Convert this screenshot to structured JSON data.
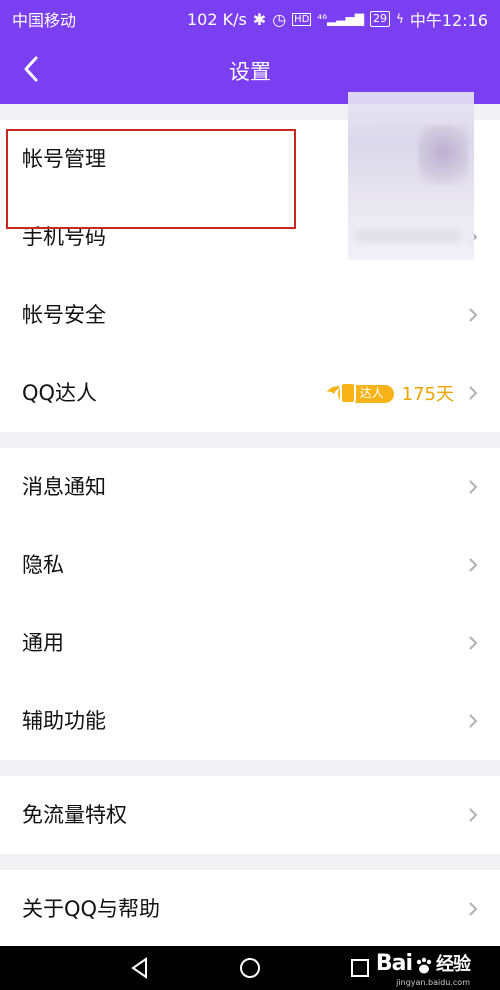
{
  "status_bar": {
    "carrier": "中国移动",
    "speed": "102 K/s",
    "battery": "29",
    "time": "中午12:16"
  },
  "header": {
    "title": "设置"
  },
  "groups": [
    {
      "items": [
        {
          "label": "帐号管理",
          "chevron": false
        },
        {
          "label": "手机号码",
          "chevron": true
        },
        {
          "label": "帐号安全",
          "chevron": true
        },
        {
          "label": "QQ达人",
          "chevron": true,
          "badge": "达人",
          "days": "175天"
        }
      ]
    },
    {
      "items": [
        {
          "label": "消息通知",
          "chevron": true
        },
        {
          "label": "隐私",
          "chevron": true
        },
        {
          "label": "通用",
          "chevron": true
        },
        {
          "label": "辅助功能",
          "chevron": true
        }
      ]
    },
    {
      "items": [
        {
          "label": "免流量特权",
          "chevron": true
        }
      ]
    },
    {
      "items": [
        {
          "label": "关于QQ与帮助",
          "chevron": true
        }
      ]
    }
  ],
  "watermark": {
    "brand": "Bai",
    "brand2": "经验",
    "url": "jingyan.baidu.com"
  },
  "colors": {
    "header": "#7b3ff2",
    "highlight": "#c8281e",
    "daren": "#f7b317"
  }
}
